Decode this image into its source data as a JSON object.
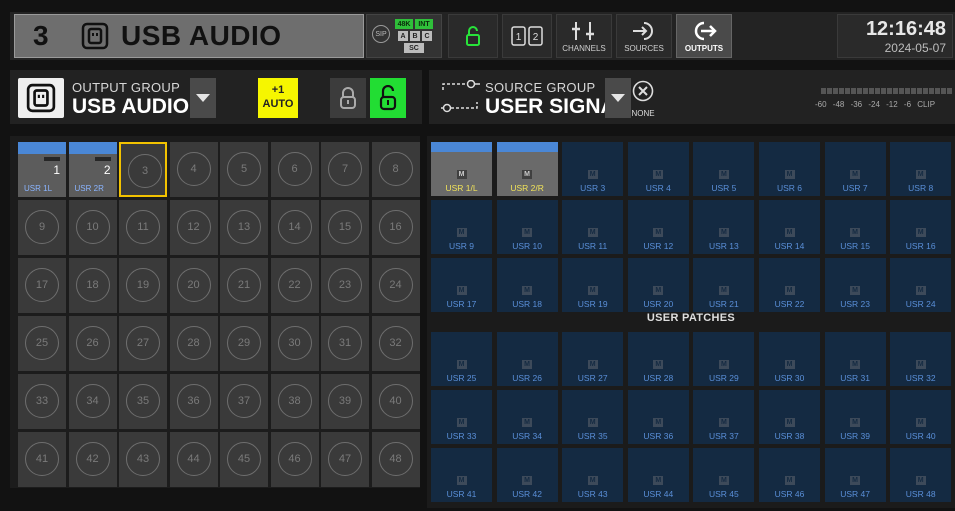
{
  "header": {
    "channel_number": "3",
    "channel_name": "USB AUDIO",
    "sip_label": "SIP",
    "clock_48k": "48K",
    "clock_int": "INT",
    "clock_a": "A",
    "clock_b": "B",
    "clock_c": "C",
    "clock_sc": "SC",
    "channels_label": "CHANNELS",
    "sources_label": "SOURCES",
    "outputs_label": "OUTPUTS",
    "time": "12:16:48",
    "date": "2024-05-07"
  },
  "output_group": {
    "label": "OUTPUT GROUP",
    "value": "USB AUDIO",
    "auto_top": "+1",
    "auto_bottom": "AUTO"
  },
  "source_group": {
    "label": "SOURCE GROUP",
    "value": "USER SIGNAL",
    "none_label": "NONE",
    "meter_scale": "-60 -48 -36 -24 -12 -6 CLIP"
  },
  "outputs": [
    {
      "num": "1",
      "usr": "USR 1L",
      "used": true
    },
    {
      "num": "2",
      "usr": "USR 2R",
      "used": true
    },
    {
      "num": "3"
    },
    {
      "num": "4"
    },
    {
      "num": "5"
    },
    {
      "num": "6"
    },
    {
      "num": "7"
    },
    {
      "num": "8"
    },
    {
      "num": "9"
    },
    {
      "num": "10"
    },
    {
      "num": "11"
    },
    {
      "num": "12"
    },
    {
      "num": "13"
    },
    {
      "num": "14"
    },
    {
      "num": "15"
    },
    {
      "num": "16"
    },
    {
      "num": "17"
    },
    {
      "num": "18"
    },
    {
      "num": "19"
    },
    {
      "num": "20"
    },
    {
      "num": "21"
    },
    {
      "num": "22"
    },
    {
      "num": "23"
    },
    {
      "num": "24"
    },
    {
      "num": "25"
    },
    {
      "num": "26"
    },
    {
      "num": "27"
    },
    {
      "num": "28"
    },
    {
      "num": "29"
    },
    {
      "num": "30"
    },
    {
      "num": "31"
    },
    {
      "num": "32"
    },
    {
      "num": "33"
    },
    {
      "num": "34"
    },
    {
      "num": "35"
    },
    {
      "num": "36"
    },
    {
      "num": "37"
    },
    {
      "num": "38"
    },
    {
      "num": "39"
    },
    {
      "num": "40"
    },
    {
      "num": "41"
    },
    {
      "num": "42"
    },
    {
      "num": "43"
    },
    {
      "num": "44"
    },
    {
      "num": "45"
    },
    {
      "num": "46"
    },
    {
      "num": "47"
    },
    {
      "num": "48"
    }
  ],
  "selected_output": "3",
  "user_patches_title": "USER PATCHES",
  "m_label": "M",
  "sources": [
    "USR 1/L",
    "USR 2/R",
    "USR 3",
    "USR 4",
    "USR 5",
    "USR 6",
    "USR 7",
    "USR 8",
    "USR 9",
    "USR 10",
    "USR 11",
    "USR 12",
    "USR 13",
    "USR 14",
    "USR 15",
    "USR 16",
    "USR 17",
    "USR 18",
    "USR 19",
    "USR 20",
    "USR 21",
    "USR 22",
    "USR 23",
    "USR 24",
    "USR 25",
    "USR 26",
    "USR 27",
    "USR 28",
    "USR 29",
    "USR 30",
    "USR 31",
    "USR 32",
    "USR 33",
    "USR 34",
    "USR 35",
    "USR 36",
    "USR 37",
    "USR 38",
    "USR 39",
    "USR 40",
    "USR 41",
    "USR 42",
    "USR 43",
    "USR 44",
    "USR 45",
    "USR 46",
    "USR 47",
    "USR 48"
  ],
  "active_sources": [
    "USR 1/L",
    "USR 2/R"
  ],
  "colors": {
    "accent_blue": "#4a87d6",
    "auto_yellow": "#f6f600",
    "unlock_green": "#22dd33",
    "selection_yellow": "#f2c200",
    "source_label_blue": "#5a8fd8",
    "active_source_label": "#f0e25a"
  },
  "icons": {
    "channel_type": "usb-icon",
    "output_group_type": "usb-icon",
    "header_unlock": "unlock-icon",
    "header_layout": "layout-1-2-icon",
    "header_channels": "sliders-icon",
    "header_sources": "input-arrow-icon",
    "header_outputs": "output-arrow-icon",
    "lock_closed": "lock-icon",
    "lock_open": "unlock-icon",
    "source_group": "signal-path-icon",
    "none": "close-circle-icon"
  }
}
